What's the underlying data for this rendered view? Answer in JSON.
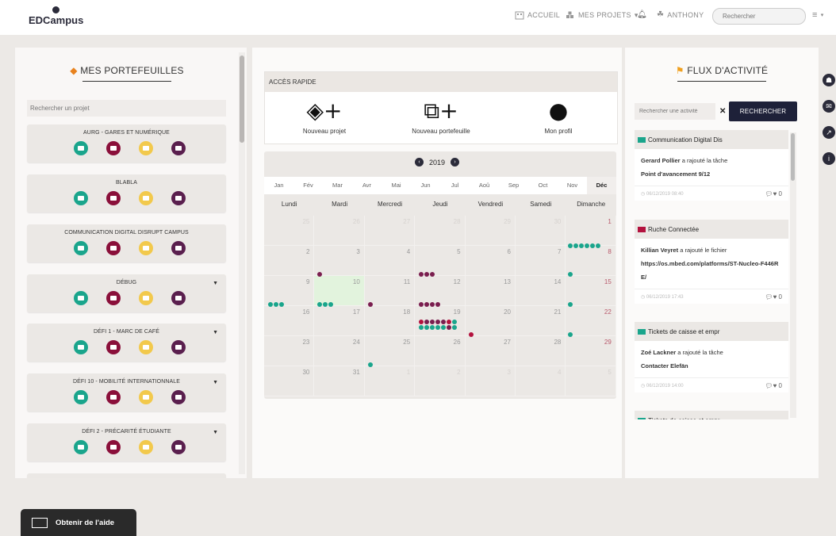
{
  "app": {
    "brand": "EDCampus"
  },
  "topnav": {
    "home": "ACCUEIL",
    "projects": "MES PROJETS",
    "user": "ANTHONY",
    "search_placeholder": "Rechercher"
  },
  "portfolios": {
    "title": "MES PORTEFEUILLES",
    "search_placeholder": "Rechercher un projet",
    "items": [
      {
        "name": "AURG - GARES ET NUMÉRIQUE",
        "caret": false
      },
      {
        "name": "BLABLA",
        "caret": false
      },
      {
        "name": "COMMUNICATION DIGITAL DISRUPT CAMPUS",
        "caret": false
      },
      {
        "name": "DÉBUG",
        "caret": true
      },
      {
        "name": "DÉFI 1 - MARC DE CAFÉ",
        "caret": true
      },
      {
        "name": "DÉFI 10 - MOBILITÉ INTERNATIONNALE",
        "caret": true
      },
      {
        "name": "DÉFI 2 - PRÉCARITÉ ÉTUDIANTE",
        "caret": true
      }
    ]
  },
  "quick_access": {
    "title": "ACCÈS RAPIDE",
    "items": [
      {
        "label": "Nouveau projet",
        "icon": "new-project-icon"
      },
      {
        "label": "Nouveau portefeuille",
        "icon": "new-portfolio-icon"
      },
      {
        "label": "Mon profil",
        "icon": "profile-icon"
      }
    ]
  },
  "calendar": {
    "year": "2019",
    "months": [
      "Jan",
      "Fév",
      "Mar",
      "Avr",
      "Mai",
      "Jun",
      "Jul",
      "Aoû",
      "Sep",
      "Oct",
      "Nov",
      "Déc"
    ],
    "active_month": "Déc",
    "weekdays": [
      "Lundi",
      "Mardi",
      "Mercredi",
      "Jeudi",
      "Vendredi",
      "Samedi",
      "Dimanche"
    ],
    "weeks": [
      [
        "25",
        "26",
        "27",
        "28",
        "29",
        "30",
        "1"
      ],
      [
        "2",
        "3",
        "4",
        "5",
        "6",
        "7",
        "8"
      ],
      [
        "9",
        "10",
        "11",
        "12",
        "13",
        "14",
        "15"
      ],
      [
        "16",
        "17",
        "18",
        "19",
        "20",
        "21",
        "22"
      ],
      [
        "23",
        "24",
        "25",
        "26",
        "27",
        "28",
        "29"
      ],
      [
        "30",
        "31",
        "1",
        "2",
        "3",
        "4",
        "5"
      ]
    ],
    "today": "10"
  },
  "activity": {
    "title": "FLUX D'ACTIVITÉ",
    "search_placeholder": "Rechercher une activité",
    "search_button": "RECHERCHER",
    "clear": "✕",
    "items": [
      {
        "project": "Communication Digital Dis",
        "user": "Gerard Pollier",
        "action": "a rajouté la tâche",
        "detail": "Point d'avancement 9/12",
        "date": "06/12/2019 08:40",
        "comments": "0"
      },
      {
        "project": "Ruche Connectée",
        "user": "Killian Veyret",
        "action": "a rajouté le fichier",
        "detail": "https://os.mbed.com/platforms/ST-Nucleo-F446RE/",
        "date": "06/12/2019 17:43",
        "comments": "0"
      },
      {
        "project": "Tickets de caisse et empr",
        "user": "Zoé Lackner",
        "action": "a rajouté la tâche",
        "detail": "Contacter Elefän",
        "date": "06/12/2019 14:00",
        "comments": "0"
      },
      {
        "project": "Tickets de caisse et empr",
        "user": "",
        "action": "",
        "detail": "",
        "date": "",
        "comments": ""
      }
    ]
  },
  "help": {
    "label": "Obtenir de l'aide"
  },
  "colors": {
    "teal": "#1aa58c",
    "maroon": "#8a0f3a",
    "yellow": "#f2c94c",
    "purple": "#5a1f4e",
    "dark": "#1e2139"
  }
}
